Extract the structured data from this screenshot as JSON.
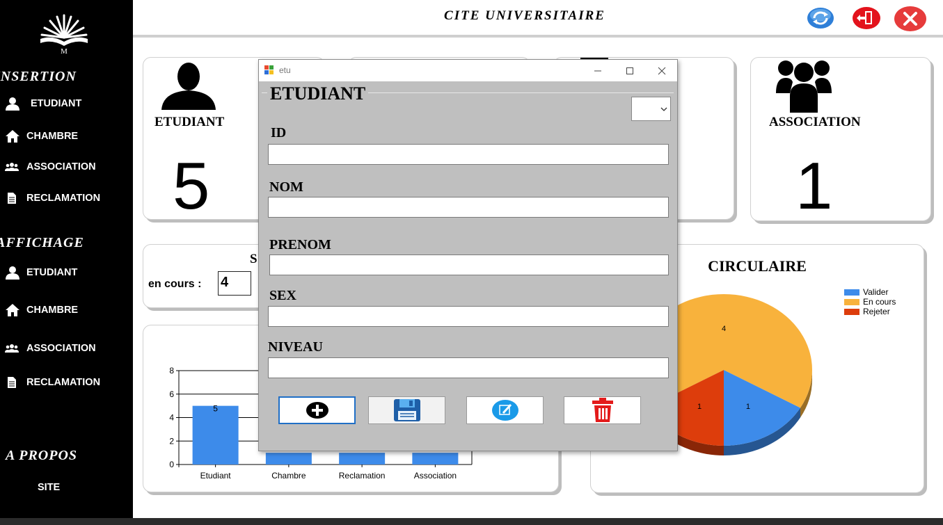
{
  "header": {
    "title": "CITE UNIVERSITAIRE",
    "refresh_icon": "refresh-icon",
    "logout_icon": "exit-door-icon",
    "close_icon": "close-icon"
  },
  "sidebar": {
    "logo_letter": "M",
    "insertion": {
      "title": "INSERTION",
      "items": [
        {
          "label": "ETUDIANT",
          "icon": "user-icon"
        },
        {
          "label": "CHAMBRE",
          "icon": "home-icon"
        },
        {
          "label": "ASSOCIATION",
          "icon": "group-icon"
        },
        {
          "label": "RECLAMATION",
          "icon": "document-icon"
        }
      ]
    },
    "affichage": {
      "title": "AFFICHAGE",
      "items": [
        {
          "label": "ETUDIANT",
          "icon": "user-icon"
        },
        {
          "label": "CHAMBRE",
          "icon": "home-icon"
        },
        {
          "label": "ASSOCIATION",
          "icon": "group-icon"
        },
        {
          "label": "RECLAMATION",
          "icon": "document-icon"
        }
      ]
    },
    "apropos": {
      "title": "A PROPOS",
      "items": [
        {
          "label": "SITE"
        }
      ]
    }
  },
  "cards": {
    "etudiant": {
      "label": "ETUDIANT",
      "count": "5",
      "icon": "user-icon"
    },
    "association": {
      "label": "ASSOCIATION",
      "count": "1",
      "icon": "group-icon"
    }
  },
  "status": {
    "title_fragment": "S",
    "en_cours_label": "en cours :",
    "en_cours_value": "4"
  },
  "chart_data": [
    {
      "type": "bar",
      "categories": [
        "Etudiant",
        "Chambre",
        "Reclamation",
        "Association"
      ],
      "values": [
        5,
        1,
        1,
        1
      ],
      "data_labels": [
        "5",
        "",
        "",
        ""
      ],
      "ylim": [
        0,
        8
      ],
      "yticks": [
        "0",
        "2",
        "4",
        "6",
        "8"
      ],
      "grid": true,
      "color": "#3d8bea"
    },
    {
      "type": "pie",
      "title": "CIRCULAIRE",
      "labels": [
        "Valider",
        "En cours",
        "Rejeter"
      ],
      "values": [
        1,
        4,
        1
      ],
      "colors": [
        "#3d8bea",
        "#f8b23c",
        "#dd3d0c"
      ],
      "legend": "top-right"
    }
  ],
  "dialog": {
    "window_title": "etu",
    "group_title": "ETUDIANT",
    "combo_value": "",
    "fields": [
      {
        "label": "ID",
        "value": ""
      },
      {
        "label": "NOM",
        "value": ""
      },
      {
        "label": "PRENOM",
        "value": ""
      },
      {
        "label": "SEX",
        "value": ""
      },
      {
        "label": "NIVEAU",
        "value": ""
      }
    ],
    "buttons": {
      "add_icon": "plus-circle-icon",
      "save_icon": "floppy-disk-icon",
      "edit_icon": "edit-icon",
      "delete_icon": "trash-icon"
    }
  }
}
